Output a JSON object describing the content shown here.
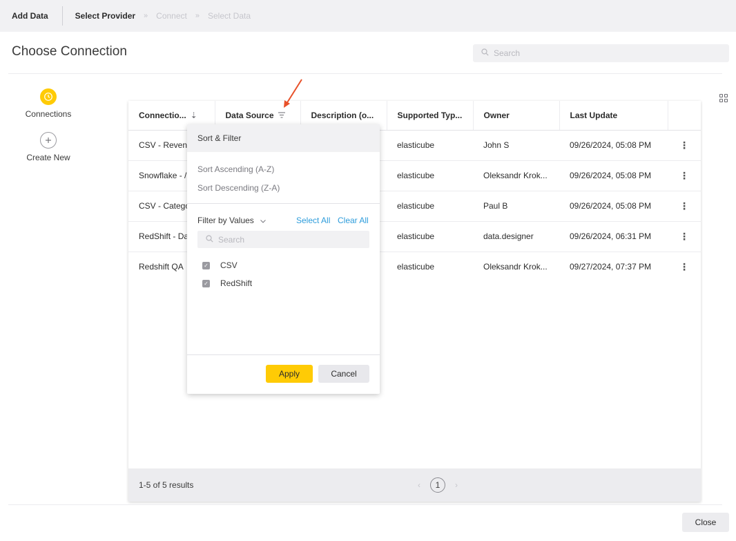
{
  "topbar": {
    "title": "Add Data",
    "steps": [
      "Select Provider",
      "Connect",
      "Select Data"
    ],
    "separator": "»"
  },
  "page": {
    "title": "Choose Connection",
    "search_placeholder": "Search"
  },
  "nav": [
    {
      "label": "Connections",
      "icon": "clock-icon",
      "active": true
    },
    {
      "label": "Create New",
      "icon": "plus-circle-icon",
      "active": false
    }
  ],
  "table": {
    "columns": [
      "Connectio...",
      "Data Source",
      "Description (o...",
      "Supported Typ...",
      "Owner",
      "Last Update",
      ""
    ],
    "rows": [
      {
        "name": "CSV - Revenu",
        "type": "elasticube",
        "owner": "John S",
        "updated": "09/26/2024, 05:08 PM"
      },
      {
        "name": "Snowflake - /",
        "type": "elasticube",
        "owner": "Oleksandr Krok...",
        "updated": "09/26/2024, 05:08 PM"
      },
      {
        "name": "CSV - Catego",
        "type": "elasticube",
        "owner": "Paul B",
        "updated": "09/26/2024, 05:08 PM"
      },
      {
        "name": "RedShift - Da",
        "type": "elasticube",
        "owner": "data.designer",
        "updated": "09/26/2024, 06:31 PM"
      },
      {
        "name": "Redshift QA",
        "type": "elasticube",
        "owner": "Oleksandr Krok...",
        "updated": "09/27/2024, 07:37 PM"
      }
    ],
    "row_menu_glyph": "⋮",
    "results_text": "1-5 of 5 results",
    "pager": {
      "prev": "‹",
      "current": "1",
      "next": "›"
    }
  },
  "popup": {
    "header": "Sort & Filter",
    "sort_asc": "Sort Ascending (A-Z)",
    "sort_desc": "Sort Descending (Z-A)",
    "filter_title": "Filter by Values",
    "select_all": "Select All",
    "clear_all": "Clear All",
    "search_placeholder": "Search",
    "values": [
      {
        "label": "CSV",
        "checked": true
      },
      {
        "label": "RedShift",
        "checked": true
      }
    ],
    "apply": "Apply",
    "cancel": "Cancel"
  },
  "close_label": "Close",
  "colors": {
    "accent": "#ffcb05",
    "link": "#2d9cdb",
    "annotation_arrow": "#e8512a"
  }
}
